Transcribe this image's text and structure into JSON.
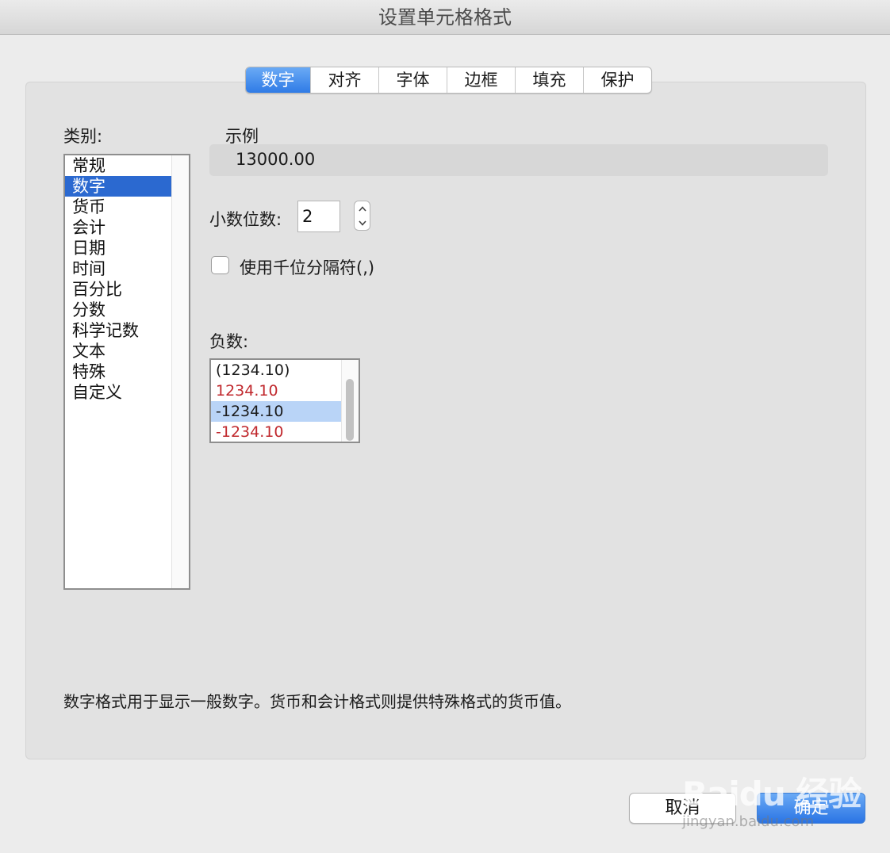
{
  "window": {
    "title": "设置单元格格式"
  },
  "tabs": [
    {
      "label": "数字",
      "active": true
    },
    {
      "label": "对齐",
      "active": false
    },
    {
      "label": "字体",
      "active": false
    },
    {
      "label": "边框",
      "active": false
    },
    {
      "label": "填充",
      "active": false
    },
    {
      "label": "保护",
      "active": false
    }
  ],
  "category": {
    "label": "类别:",
    "items": [
      "常规",
      "数字",
      "货币",
      "会计",
      "日期",
      "时间",
      "百分比",
      "分数",
      "科学记数",
      "文本",
      "特殊",
      "自定义"
    ],
    "selected": "数字"
  },
  "sample": {
    "label": "示例",
    "value": "13000.00"
  },
  "decimals": {
    "label": "小数位数:",
    "value": "2"
  },
  "thousands_separator": {
    "label": "使用千位分隔符(,)",
    "checked": false
  },
  "negative_numbers": {
    "label": "负数:",
    "items": [
      {
        "text": "(1234.10)",
        "color": "#1b1b1b"
      },
      {
        "text": "1234.10",
        "color": "#c0282d"
      },
      {
        "text": "-1234.10",
        "color": "#1b1b1b"
      },
      {
        "text": "-1234.10",
        "color": "#c0282d"
      }
    ],
    "selected": "-1234.10"
  },
  "description": "数字格式用于显示一般数字。货币和会计格式则提供特殊格式的货币值。",
  "buttons": {
    "cancel": "取消",
    "ok": "确定"
  },
  "watermark": {
    "main": "Baidu 经验",
    "sub": "jingyan.baidu.com"
  },
  "colors": {
    "accent": "#2b69d0",
    "selected_light": "#b9d4f7",
    "negative_red": "#c0282d"
  }
}
